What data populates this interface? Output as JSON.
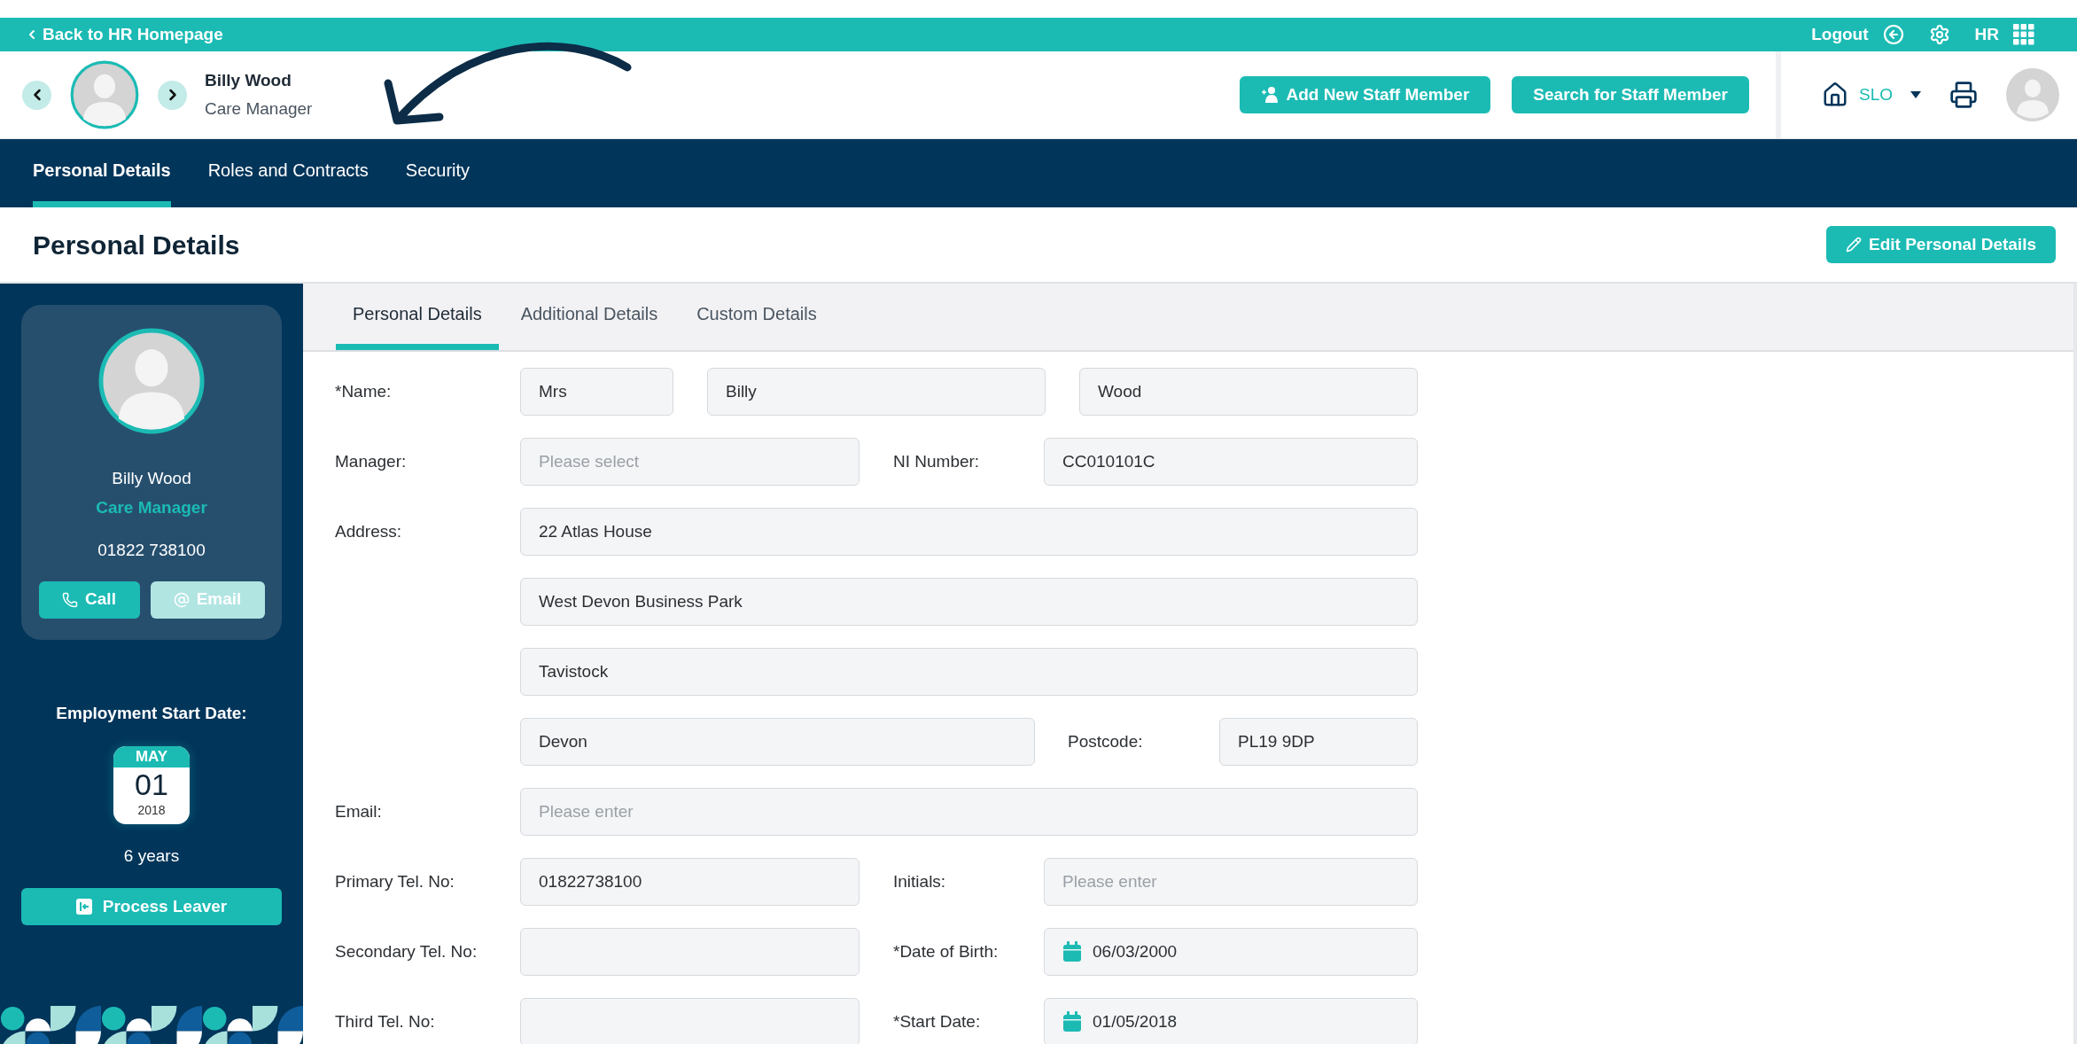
{
  "top_bar": {
    "back_link": "Back to HR Homepage",
    "logout": "Logout",
    "app_label": "HR"
  },
  "header": {
    "employee_name": "Billy Wood",
    "employee_role": "Care Manager",
    "buttons": [
      "Add New Staff Member",
      "Search for Staff Member"
    ],
    "location": "SLO"
  },
  "nav_tabs": [
    {
      "label": "Personal Details",
      "selected": true
    },
    {
      "label": "Roles and Contracts",
      "selected": false
    },
    {
      "label": "Security",
      "selected": false
    }
  ],
  "page_title": "Personal Details",
  "edit_button": "Edit Personal Details",
  "profile_card": {
    "name": "Billy Wood",
    "role": "Care Manager",
    "phone": "01822 738100",
    "actions": [
      {
        "label": "Call",
        "kind": "call",
        "disabled": false
      },
      {
        "label": "Email",
        "kind": "email",
        "disabled": true
      }
    ]
  },
  "employment": {
    "heading": "Employment Start Date:",
    "month": "MAY",
    "day": "01",
    "year": "2018",
    "duration": "6 years",
    "leaver_button": "Process Leaver"
  },
  "sub_tabs": [
    {
      "label": "Personal Details",
      "selected": true
    },
    {
      "label": "Additional Details",
      "selected": false
    },
    {
      "label": "Custom Details",
      "selected": false
    }
  ],
  "form_rows": [
    [
      {
        "kind": "label",
        "text": "*Name:"
      },
      {
        "kind": "input",
        "value": "Mrs"
      },
      {
        "kind": "input",
        "value": "Billy"
      },
      {
        "kind": "input",
        "value": "Wood"
      }
    ],
    [
      {
        "kind": "label",
        "text": "Manager:"
      },
      {
        "kind": "input",
        "placeholder": "Please select"
      },
      {
        "kind": "label",
        "text": "NI Number:"
      },
      {
        "kind": "input",
        "value": "CC010101C"
      }
    ],
    [
      {
        "kind": "label",
        "text": "Address:"
      },
      {
        "kind": "input",
        "value": "22 Atlas House"
      }
    ],
    [
      {
        "kind": "input",
        "value": "West Devon Business Park"
      }
    ],
    [
      {
        "kind": "input",
        "value": "Tavistock"
      }
    ],
    [
      {
        "kind": "input",
        "value": "Devon"
      },
      {
        "kind": "label",
        "text": "Postcode:"
      },
      {
        "kind": "input",
        "value": "PL19 9DP"
      }
    ],
    [
      {
        "kind": "label",
        "text": "Email:"
      },
      {
        "kind": "input",
        "placeholder": "Please enter"
      }
    ],
    [
      {
        "kind": "label",
        "text": "Primary Tel. No:"
      },
      {
        "kind": "input",
        "value": "01822738100"
      },
      {
        "kind": "label",
        "text": "Initials:"
      },
      {
        "kind": "input",
        "placeholder": "Please enter"
      }
    ],
    [
      {
        "kind": "label",
        "text": "Secondary Tel. No:"
      },
      {
        "kind": "input"
      },
      {
        "kind": "label",
        "text": "*Date of Birth:"
      },
      {
        "kind": "date",
        "value": "06/03/2000"
      }
    ],
    [
      {
        "kind": "label",
        "text": "Third Tel. No:"
      },
      {
        "kind": "input"
      },
      {
        "kind": "label",
        "text": "*Start Date:"
      },
      {
        "kind": "date",
        "value": "01/05/2018"
      }
    ]
  ]
}
